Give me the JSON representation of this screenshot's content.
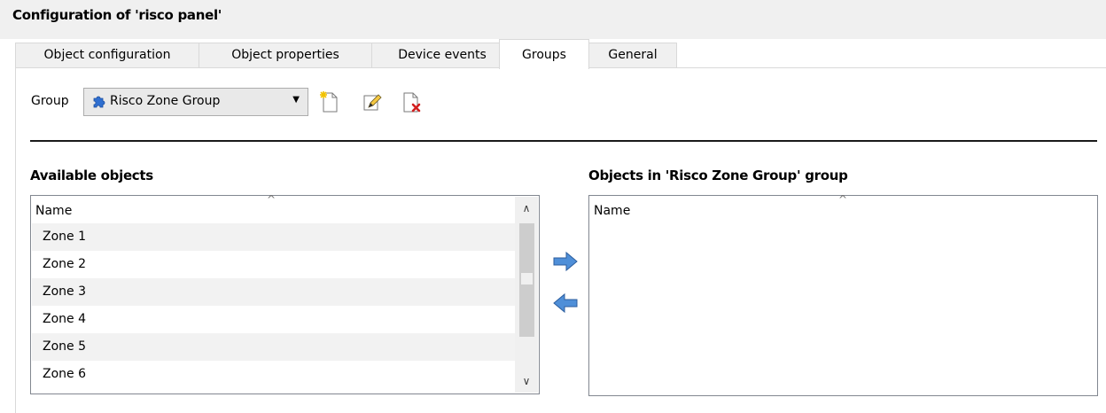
{
  "window": {
    "title": "Configuration of 'risco panel'"
  },
  "tabs": [
    {
      "label": "Object configuration",
      "active": false
    },
    {
      "label": "Object properties",
      "active": false
    },
    {
      "label": "Device events",
      "active": false
    },
    {
      "label": "Groups",
      "active": true
    },
    {
      "label": "General",
      "active": false
    }
  ],
  "group": {
    "label": "Group",
    "selected": "Risco Zone Group",
    "new_icon": "new-document-icon",
    "edit_icon": "edit-pencil-icon",
    "delete_icon": "delete-document-icon"
  },
  "available": {
    "heading": "Available objects",
    "column": "Name",
    "items": [
      "Zone 1",
      "Zone 2",
      "Zone 3",
      "Zone 4",
      "Zone 5",
      "Zone 6"
    ]
  },
  "transfer": {
    "add_icon": "arrow-right-icon",
    "remove_icon": "arrow-left-icon"
  },
  "assigned": {
    "heading": "Objects in 'Risco Zone Group' group",
    "column": "Name",
    "items": []
  },
  "colors": {
    "arrow_blue": "#4f8fd8",
    "accent_red": "#d21f1f",
    "header_bg": "#f0f0f0"
  }
}
